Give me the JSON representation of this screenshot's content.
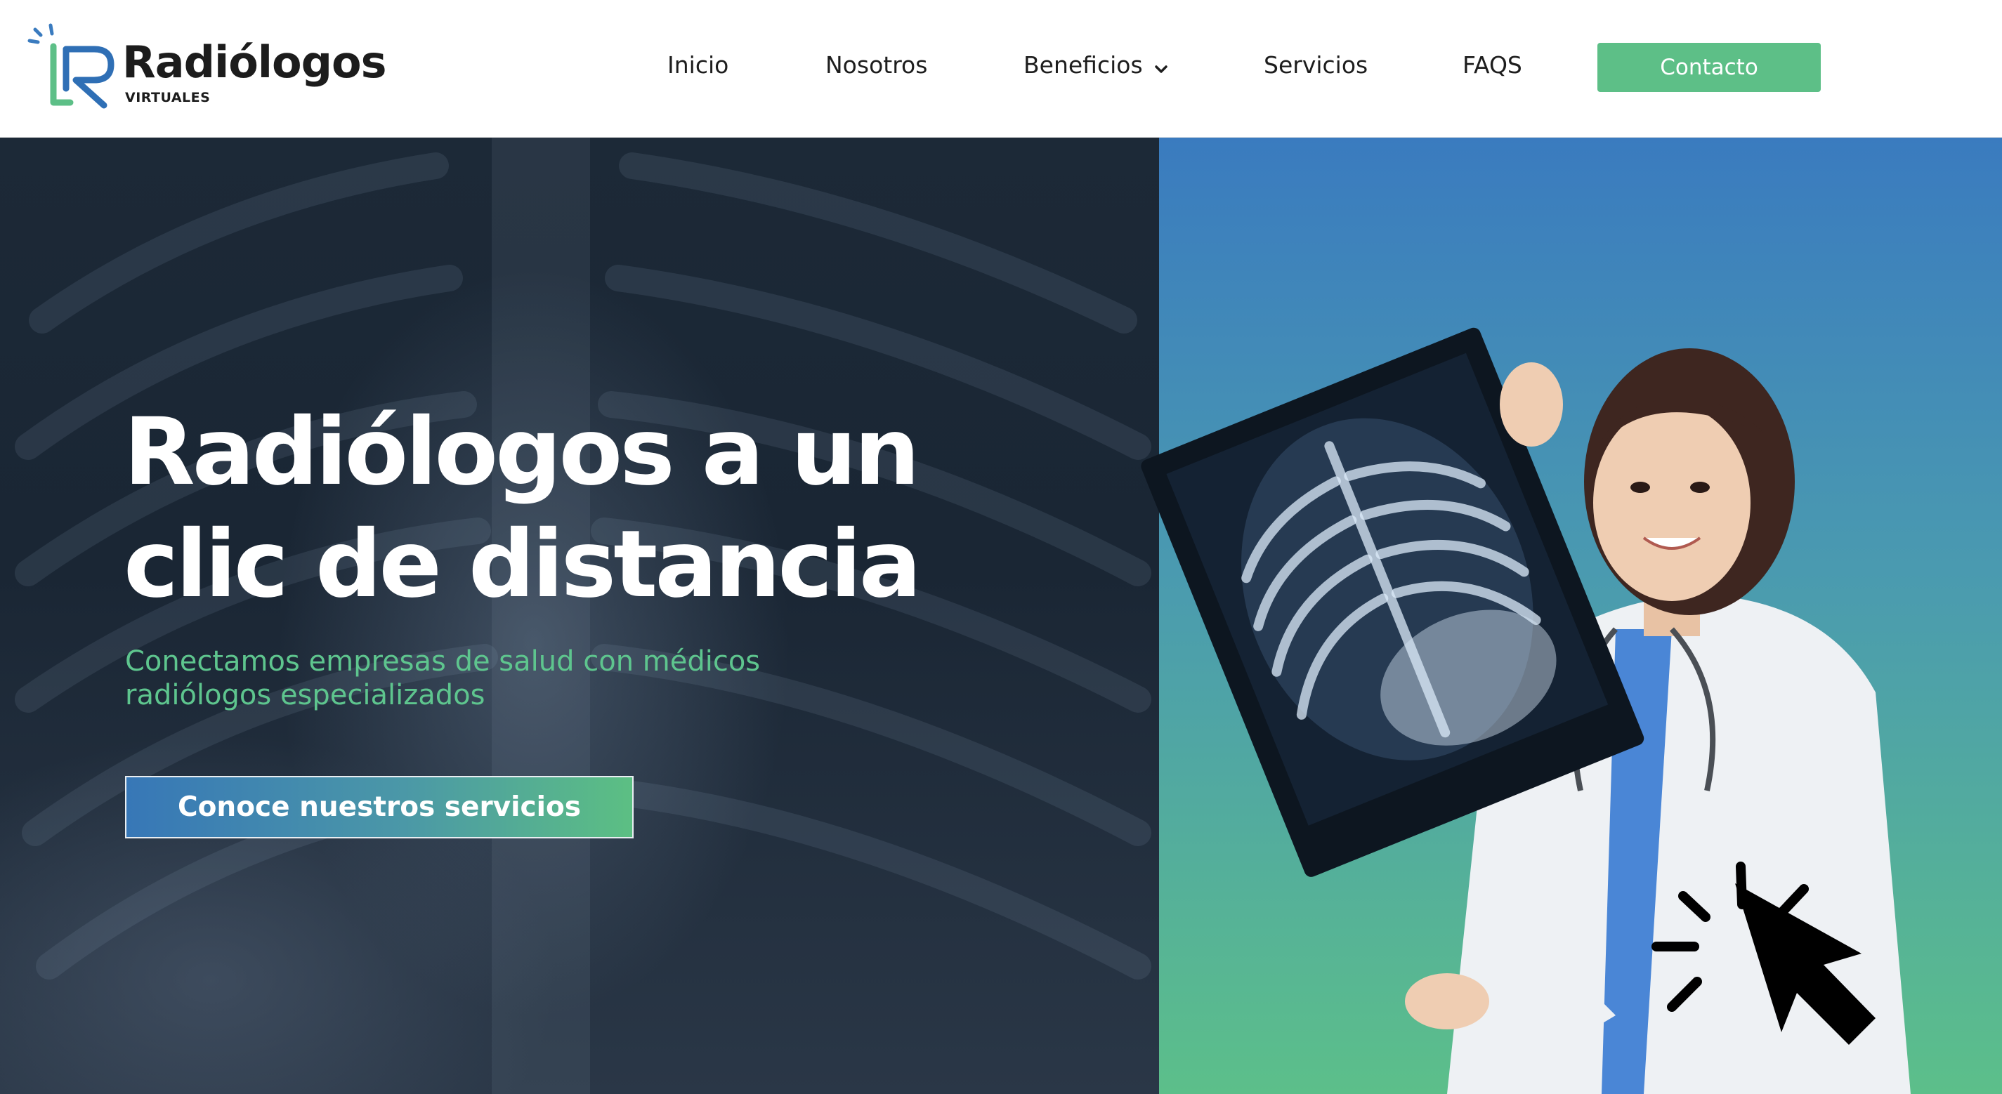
{
  "brand": {
    "name": "Radiólogos",
    "tagline": "VIRTUALES",
    "colors": {
      "green": "#5dbf87",
      "blue": "#3a7bbf",
      "dark": "#1c2937"
    }
  },
  "nav": {
    "items": [
      {
        "label": "Inicio"
      },
      {
        "label": "Nosotros"
      },
      {
        "label": "Beneficios",
        "icon": "chevron-down-icon"
      },
      {
        "label": "Servicios"
      },
      {
        "label": "FAQS"
      }
    ],
    "contact_label": "Contacto"
  },
  "hero": {
    "title_line1": "Radiólogos a un",
    "title_line2": "clic de distancia",
    "subtitle_line1": "Conectamos empresas de salud con médicos",
    "subtitle_line2": "radiólogos especializados",
    "cta_label": "Conoce nuestros servicios",
    "image": "doctor-holding-xray",
    "cursor_icon": "click-cursor-icon"
  }
}
